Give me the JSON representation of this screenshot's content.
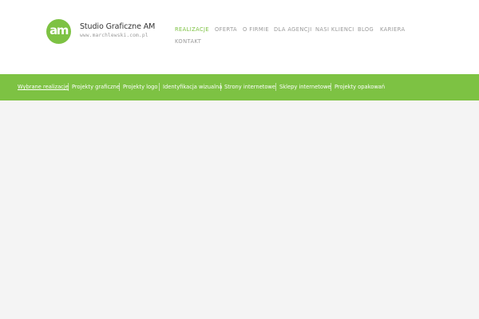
{
  "brand": {
    "logo_text": "am",
    "name": "Studio Graficzne AM",
    "url": "www.marchlewski.com.pl",
    "accent_color": "#7dc243"
  },
  "main_nav": {
    "items": [
      {
        "label": "REALIZACJE",
        "active": true
      },
      {
        "label": "OFERTA"
      },
      {
        "label": "O FIRMIE"
      },
      {
        "label": "DLA AGENCJI"
      },
      {
        "label": "NASI KLIENCI"
      },
      {
        "label": "BLOG"
      },
      {
        "label": "KARIERA"
      },
      {
        "label": "KONTAKT"
      }
    ]
  },
  "sub_nav": {
    "items": [
      {
        "label": "Wybrane realizacje",
        "active": true
      },
      {
        "label": "Projekty graficzne"
      },
      {
        "label": "Projekty logo"
      },
      {
        "label": "Identyfikacja wizualna"
      },
      {
        "label": "Strony internetowe"
      },
      {
        "label": "Sklepy internetowe"
      },
      {
        "label": "Projekty opakowań"
      }
    ]
  }
}
